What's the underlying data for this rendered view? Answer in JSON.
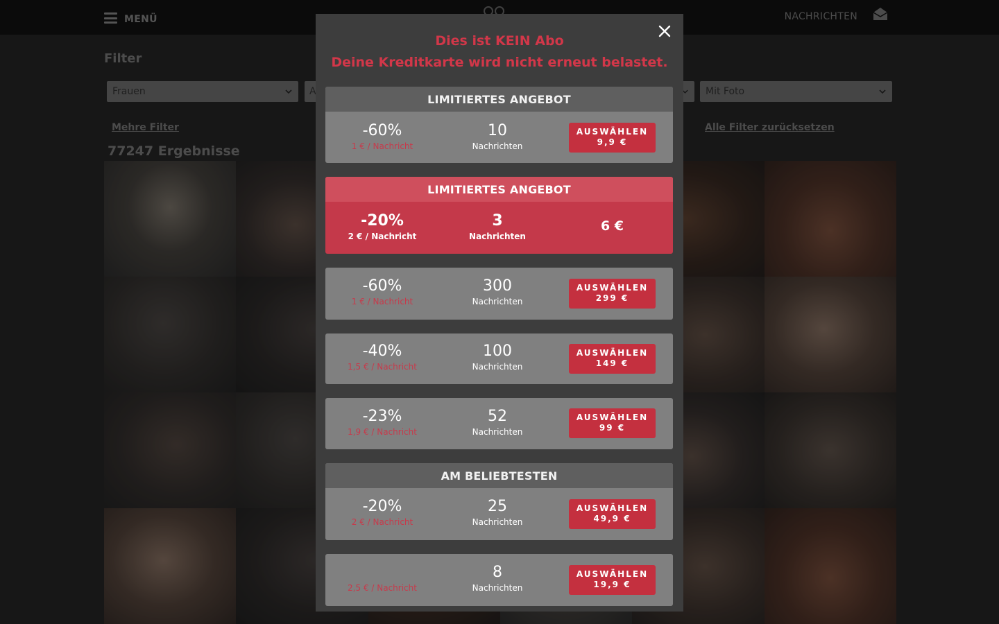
{
  "nav": {
    "menu_label": "MENÜ",
    "messages_label": "NACHRICHTEN"
  },
  "filter": {
    "heading": "Filter",
    "gender_value": "Frauen",
    "second_value": "A",
    "photo_value": "Mit Foto",
    "more_filters": "Mehre Filter",
    "reset_filters": "Alle Filter zurücksetzen",
    "results": "77247 Ergebnisse"
  },
  "modal": {
    "title_line1": "Dies ist KEIN Abo",
    "title_line2": "Deine Kreditkarte wird nicht erneut belastet.",
    "offers": [
      {
        "banner": "LIMITIERTES ANGEBOT",
        "discount": "-60%",
        "unit_price": "1 € / Nachricht",
        "count": "10",
        "count_label": "Nachrichten",
        "button_label": "AUSWÄHLEN",
        "price": "9,9 €"
      },
      {
        "banner": "LIMITIERTES ANGEBOT",
        "discount": "-20%",
        "unit_price": "2 € / Nachricht",
        "count": "3",
        "count_label": "Nachrichten",
        "price": "6 €"
      },
      {
        "discount": "-60%",
        "unit_price": "1 € / Nachricht",
        "count": "300",
        "count_label": "Nachrichten",
        "button_label": "AUSWÄHLEN",
        "price": "299 €"
      },
      {
        "discount": "-40%",
        "unit_price": "1,5 € / Nachricht",
        "count": "100",
        "count_label": "Nachrichten",
        "button_label": "AUSWÄHLEN",
        "price": "149 €"
      },
      {
        "discount": "-23%",
        "unit_price": "1,9 € / Nachricht",
        "count": "52",
        "count_label": "Nachrichten",
        "button_label": "AUSWÄHLEN",
        "price": "99 €"
      },
      {
        "banner": "AM BELIEBTESTEN",
        "discount": "-20%",
        "unit_price": "2 € / Nachricht",
        "count": "25",
        "count_label": "Nachrichten",
        "button_label": "AUSWÄHLEN",
        "price": "49,9 €"
      },
      {
        "discount": "",
        "unit_price": "2,5 € / Nachricht",
        "count": "8",
        "count_label": "Nachrichten",
        "button_label": "AUSWÄHLEN",
        "price": "19,9 €"
      }
    ]
  },
  "colors": {
    "accent": "#c4303f",
    "modal_bg": "#3d3d3d",
    "card_bg": "#808080",
    "banner_bg": "#5f5f5f"
  }
}
